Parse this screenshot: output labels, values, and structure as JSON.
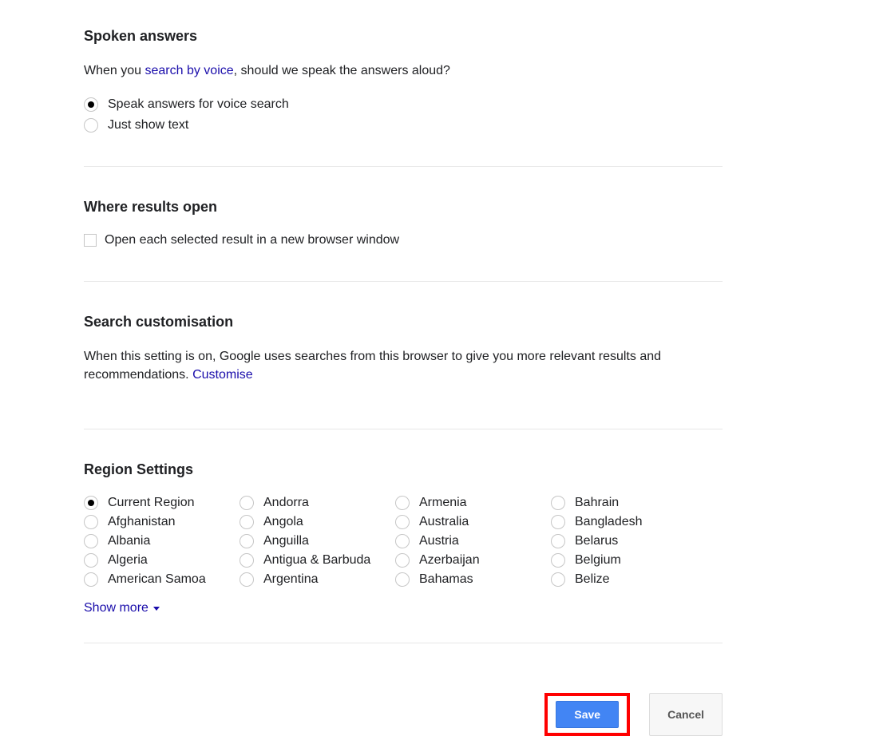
{
  "spoken": {
    "title": "Spoken answers",
    "desc_prefix": "When you ",
    "desc_link": "search by voice",
    "desc_suffix": ", should we speak the answers aloud?",
    "options": [
      {
        "label": "Speak answers for voice search",
        "selected": true
      },
      {
        "label": "Just show text",
        "selected": false
      }
    ]
  },
  "whereOpen": {
    "title": "Where results open",
    "checkbox_label": "Open each selected result in a new browser window",
    "checked": false
  },
  "customisation": {
    "title": "Search customisation",
    "desc_prefix": "When this setting is on, Google uses searches from this browser to give you more relevant results and recommendations. ",
    "desc_link": "Customise"
  },
  "region": {
    "title": "Region Settings",
    "show_more": "Show more",
    "columns": [
      [
        {
          "label": "Current Region",
          "selected": true
        },
        {
          "label": "Afghanistan",
          "selected": false
        },
        {
          "label": "Albania",
          "selected": false
        },
        {
          "label": "Algeria",
          "selected": false
        },
        {
          "label": "American Samoa",
          "selected": false
        }
      ],
      [
        {
          "label": "Andorra",
          "selected": false
        },
        {
          "label": "Angola",
          "selected": false
        },
        {
          "label": "Anguilla",
          "selected": false
        },
        {
          "label": "Antigua & Barbuda",
          "selected": false
        },
        {
          "label": "Argentina",
          "selected": false
        }
      ],
      [
        {
          "label": "Armenia",
          "selected": false
        },
        {
          "label": "Australia",
          "selected": false
        },
        {
          "label": "Austria",
          "selected": false
        },
        {
          "label": "Azerbaijan",
          "selected": false
        },
        {
          "label": "Bahamas",
          "selected": false
        }
      ],
      [
        {
          "label": "Bahrain",
          "selected": false
        },
        {
          "label": "Bangladesh",
          "selected": false
        },
        {
          "label": "Belarus",
          "selected": false
        },
        {
          "label": "Belgium",
          "selected": false
        },
        {
          "label": "Belize",
          "selected": false
        }
      ]
    ]
  },
  "actions": {
    "save": "Save",
    "cancel": "Cancel"
  }
}
